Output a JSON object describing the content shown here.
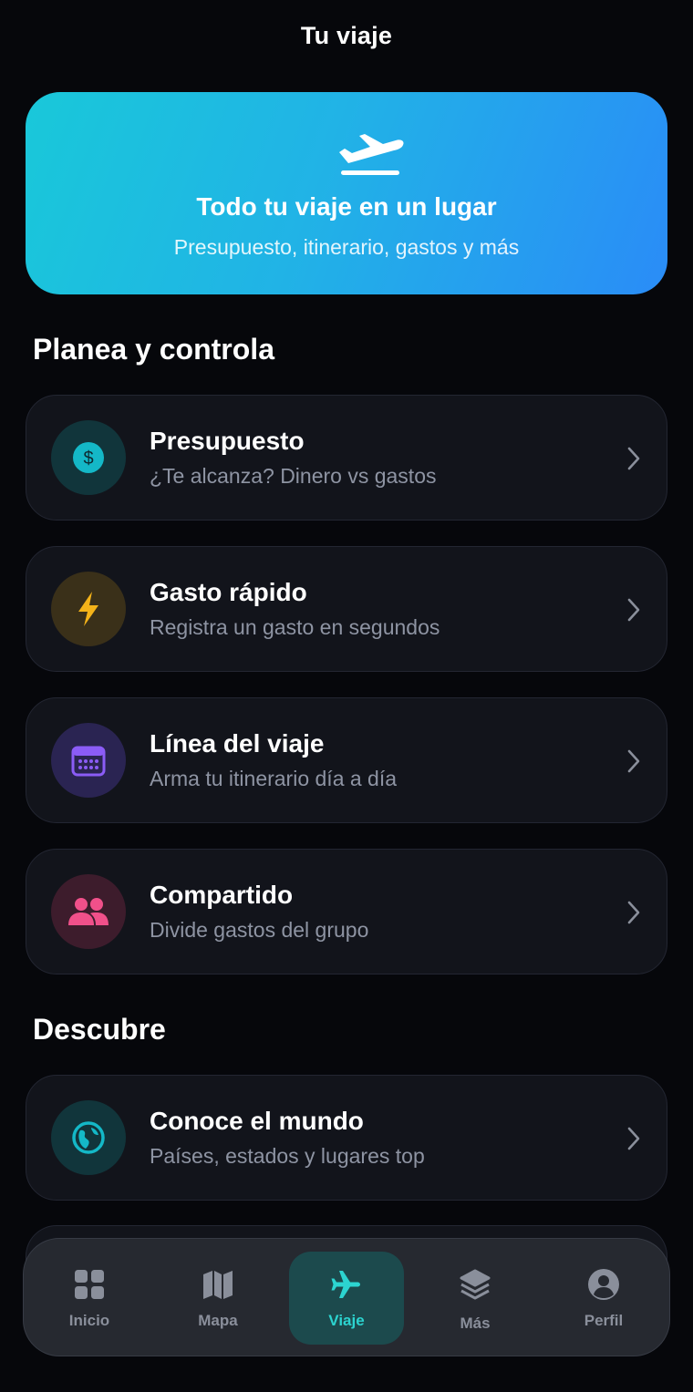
{
  "header": {
    "title": "Tu viaje"
  },
  "hero": {
    "icon": "airplane-takeoff-icon",
    "title": "Todo tu viaje en un lugar",
    "subtitle": "Presupuesto, itinerario, gastos y más"
  },
  "sections": {
    "plan": {
      "title": "Planea y controla",
      "items": [
        {
          "title": "Presupuesto",
          "subtitle": "¿Te alcanza? Dinero vs gastos",
          "icon": "dollar-coin-icon",
          "color": "#14b8c7"
        },
        {
          "title": "Gasto rápido",
          "subtitle": "Registra un gasto en segundos",
          "icon": "lightning-bolt-icon",
          "color": "#f4b319"
        },
        {
          "title": "Línea del viaje",
          "subtitle": "Arma tu itinerario día a día",
          "icon": "calendar-icon",
          "color": "#8b5cf6"
        },
        {
          "title": "Compartido",
          "subtitle": "Divide gastos del grupo",
          "icon": "group-users-icon",
          "color": "#f0508a"
        }
      ]
    },
    "discover": {
      "title": "Descubre",
      "items": [
        {
          "title": "Conoce el mundo",
          "subtitle": "Países, estados y lugares top",
          "icon": "globe-icon",
          "color": "#14b8c7"
        }
      ]
    }
  },
  "tabbar": {
    "tabs": [
      {
        "label": "Inicio",
        "icon": "grid-icon",
        "active": false
      },
      {
        "label": "Mapa",
        "icon": "map-icon",
        "active": false
      },
      {
        "label": "Viaje",
        "icon": "airplane-icon",
        "active": true
      },
      {
        "label": "Más",
        "icon": "layers-icon",
        "active": false
      },
      {
        "label": "Perfil",
        "icon": "profile-icon",
        "active": false
      }
    ]
  }
}
